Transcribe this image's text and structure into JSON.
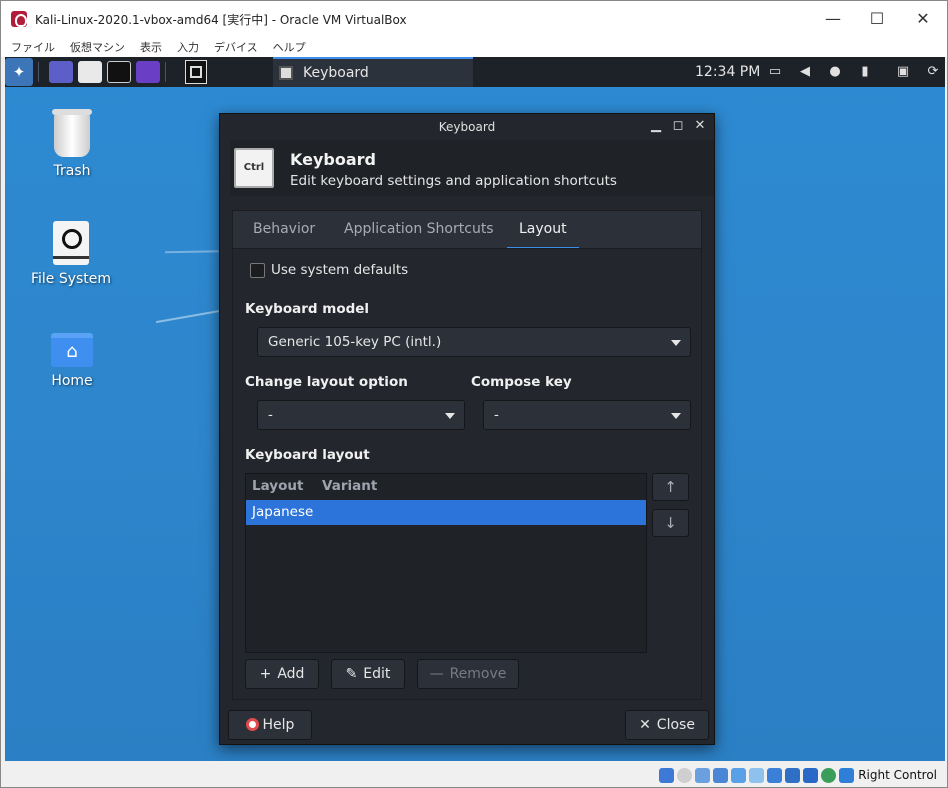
{
  "host": {
    "title": "Kali-Linux-2020.1-vbox-amd64 [実行中] - Oracle VM VirtualBox",
    "menu": [
      "ファイル",
      "仮想マシン",
      "表示",
      "入力",
      "デバイス",
      "ヘルプ"
    ],
    "controls": {
      "minimize": "—",
      "maximize": "☐",
      "close": "✕"
    },
    "statusbar": {
      "host_key": "Right Control"
    }
  },
  "panel": {
    "taskbar_item": "Keyboard",
    "clock": "12:34 PM"
  },
  "desktop": {
    "icons": [
      {
        "label": "Trash"
      },
      {
        "label": "File System"
      },
      {
        "label": "Home"
      }
    ]
  },
  "dialog": {
    "window_title": "Keyboard",
    "controls": {
      "minimize": "▁",
      "maximize": "◻",
      "close": "✕"
    },
    "header_icon_text": "Ctrl",
    "header_title": "Keyboard",
    "header_subtitle": "Edit keyboard settings and application shortcuts",
    "tabs": [
      {
        "label": "Behavior",
        "active": false
      },
      {
        "label": "Application Shortcuts",
        "active": false
      },
      {
        "label": "Layout",
        "active": true
      }
    ],
    "use_system_defaults": {
      "label": "Use system defaults",
      "checked": false
    },
    "keyboard_model": {
      "label": "Keyboard model",
      "value": "Generic 105-key PC (intl.)"
    },
    "change_layout_option": {
      "label": "Change layout option",
      "value": "-"
    },
    "compose_key": {
      "label": "Compose key",
      "value": "-"
    },
    "keyboard_layout": {
      "label": "Keyboard layout",
      "columns": [
        "Layout",
        "Variant"
      ],
      "rows": [
        {
          "layout": "Japanese",
          "variant": "",
          "selected": true
        }
      ]
    },
    "move_up": "↑",
    "move_down": "↓",
    "buttons": {
      "add": "Add",
      "edit": "Edit",
      "remove": "Remove",
      "help": "Help",
      "close": "Close"
    },
    "button_icons": {
      "add": "+",
      "edit": "✎",
      "remove": "—",
      "close": "✕"
    }
  },
  "colors": {
    "accent": "#3c8ee8",
    "selection": "#2d74da",
    "desktop": "#2e86cc"
  }
}
